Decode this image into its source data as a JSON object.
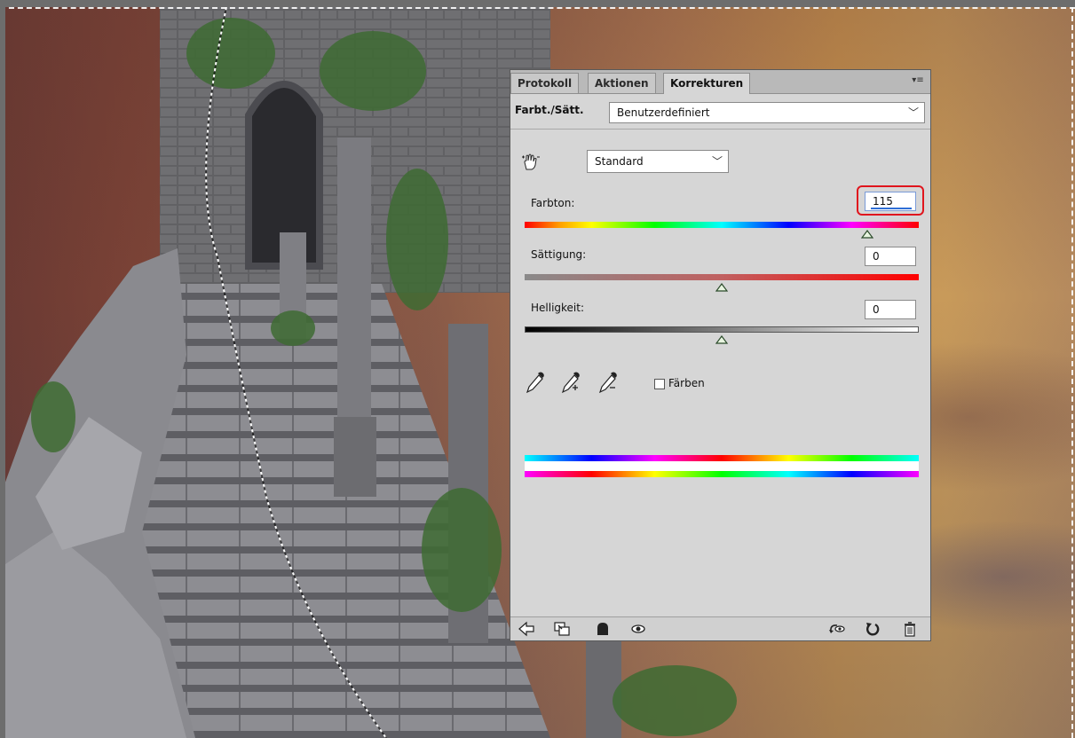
{
  "panel": {
    "tabs": [
      {
        "label": "Protokoll"
      },
      {
        "label": "Aktionen"
      },
      {
        "label": "Korrekturen"
      }
    ],
    "active_tab": "Korrekturen",
    "menu_icon": "panel-menu-icon",
    "adjustment_name": "Farbt./Sätt.",
    "preset": {
      "value": "Benutzerdefiniert"
    },
    "channel": {
      "value": "Standard"
    },
    "hue": {
      "label": "Farbton:",
      "value": "115",
      "fraction": 0.87
    },
    "saturation": {
      "label": "Sättigung:",
      "value": "0",
      "fraction": 0.5
    },
    "lightness": {
      "label": "Helligkeit:",
      "value": "0",
      "fraction": 0.5
    },
    "colorize": {
      "label": "Färben",
      "checked": false
    },
    "highlight_color": "#e0151d"
  },
  "footer_icons": [
    "back-arrow-icon",
    "clip-to-layer-icon",
    "mask-visibility-icon",
    "eye-icon",
    "previous-state-icon",
    "reset-icon",
    "trash-icon"
  ]
}
